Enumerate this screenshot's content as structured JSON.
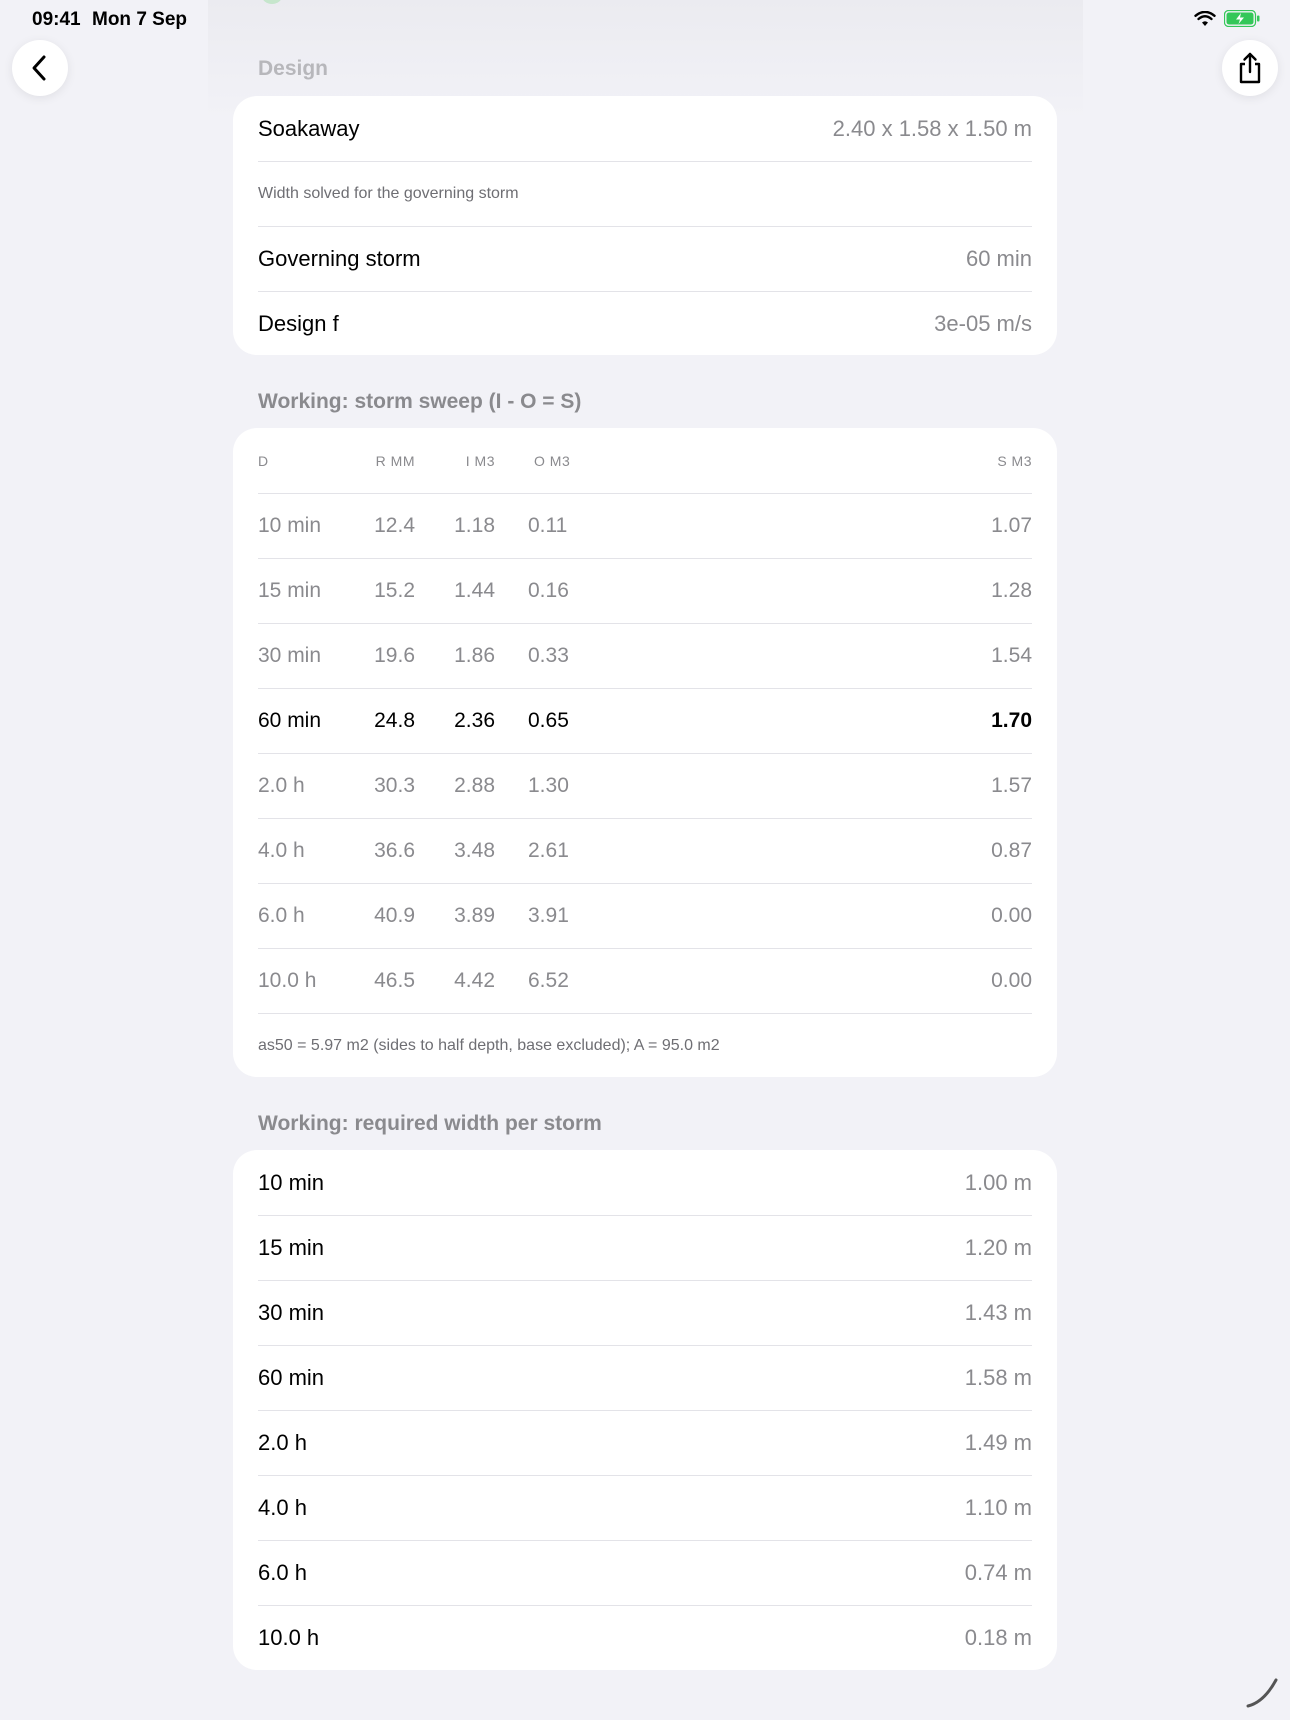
{
  "status": {
    "time": "09:41",
    "date": "Mon 7 Sep"
  },
  "icons": {
    "back": "chevron-left-icon",
    "share": "share-icon",
    "wifi": "wifi-icon",
    "battery": "battery-charging-icon"
  },
  "colors": {
    "battery": "#34c759",
    "secondary_text": "#8a8a8e",
    "background": "#f2f2f7"
  },
  "design": {
    "header": "Design",
    "rows": [
      {
        "label": "Soakaway",
        "value": "2.40 x 1.58 x 1.50 m"
      },
      {
        "note": "Width solved for the governing storm"
      },
      {
        "label": "Governing storm",
        "value": "60 min"
      },
      {
        "label": "Design f",
        "value": "3e-05 m/s"
      }
    ]
  },
  "sweep": {
    "header": "Working: storm sweep (I - O = S)",
    "columns": [
      "D",
      "R MM",
      "I M3",
      "O M3",
      "S M3"
    ],
    "rows": [
      [
        "10 min",
        "12.4",
        "1.18",
        "0.11",
        "1.07"
      ],
      [
        "15 min",
        "15.2",
        "1.44",
        "0.16",
        "1.28"
      ],
      [
        "30 min",
        "19.6",
        "1.86",
        "0.33",
        "1.54"
      ],
      [
        "60 min",
        "24.8",
        "2.36",
        "0.65",
        "1.70"
      ],
      [
        "2.0 h",
        "30.3",
        "2.88",
        "1.30",
        "1.57"
      ],
      [
        "4.0 h",
        "36.6",
        "3.48",
        "2.61",
        "0.87"
      ],
      [
        "6.0 h",
        "40.9",
        "3.89",
        "3.91",
        "0.00"
      ],
      [
        "10.0 h",
        "46.5",
        "4.42",
        "6.52",
        "0.00"
      ]
    ],
    "highlight_row": 3,
    "footnote": "as50 = 5.97 m2 (sides to half depth, base excluded); A = 95.0 m2"
  },
  "widths": {
    "header": "Working: required width per storm",
    "rows": [
      {
        "label": "10 min",
        "value": "1.00 m"
      },
      {
        "label": "15 min",
        "value": "1.20 m"
      },
      {
        "label": "30 min",
        "value": "1.43 m"
      },
      {
        "label": "60 min",
        "value": "1.58 m"
      },
      {
        "label": "2.0 h",
        "value": "1.49 m"
      },
      {
        "label": "4.0 h",
        "value": "1.10 m"
      },
      {
        "label": "6.0 h",
        "value": "0.74 m"
      },
      {
        "label": "10.0 h",
        "value": "0.18 m"
      }
    ]
  }
}
